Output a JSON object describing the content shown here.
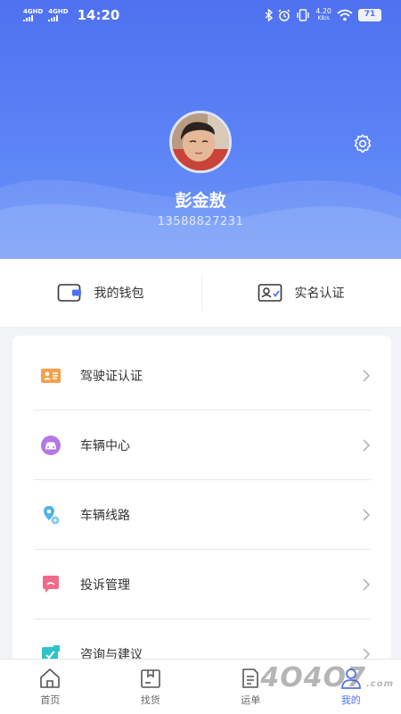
{
  "status_bar": {
    "network1": "4GHD",
    "network2": "4GHD",
    "time": "14:20",
    "speed_value": "4.20",
    "speed_unit": "KB/s",
    "battery": "71"
  },
  "profile": {
    "name": "彭金敖",
    "phone": "13588827231"
  },
  "quick_actions": [
    {
      "label": "我的钱包",
      "icon": "wallet-icon"
    },
    {
      "label": "实名认证",
      "icon": "id-card-icon"
    }
  ],
  "menu": [
    {
      "label": "驾驶证认证",
      "icon": "license-icon",
      "color": "#f5a04a"
    },
    {
      "label": "车辆中心",
      "icon": "car-icon",
      "color": "#b477e6"
    },
    {
      "label": "车辆线路",
      "icon": "route-icon",
      "color": "#4fb3e8"
    },
    {
      "label": "投诉管理",
      "icon": "complaint-icon",
      "color": "#f06a8c"
    },
    {
      "label": "咨询与建议",
      "icon": "feedback-icon",
      "color": "#2ec3c9"
    }
  ],
  "tabs": [
    {
      "label": "首页",
      "icon": "home-icon"
    },
    {
      "label": "找货",
      "icon": "goods-icon"
    },
    {
      "label": "运单",
      "icon": "waybill-icon"
    },
    {
      "label": "我的",
      "icon": "profile-icon",
      "active": true
    }
  ],
  "colors": {
    "primary": "#4f71f0",
    "header_gradient_end": "#6c96f8"
  }
}
